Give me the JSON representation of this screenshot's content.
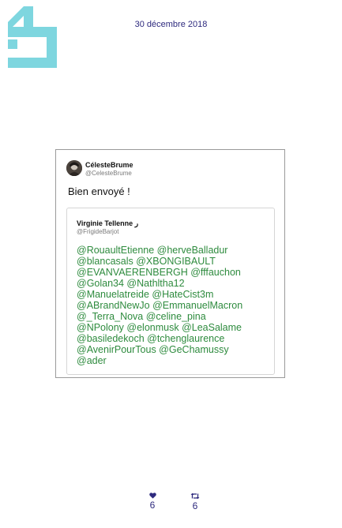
{
  "header": {
    "date": "30 décembre 2018"
  },
  "tweet": {
    "author_name": "CélesteBrume",
    "author_handle": "@CelesteBrume",
    "text": "Bien envoyé !",
    "quoted": {
      "author_name": "Virginie Tellenne ر",
      "author_handle": "@FrigideBarjot",
      "mention_lines": [
        "@RouaultEtienne @herveBalladur",
        "@blancasals @XBONGIBAULT",
        "@EVANVAERENBERGH @fffauchon",
        "@Golan34 @Nathltha12",
        "@Manuelatreide @HateCist3m",
        "@ABrandNewJo @EmmanuelMacron",
        "@_Terra_Nova @celine_pina",
        "@NPolony @elonmusk @LeaSalame",
        "@basiledekoch @tchenglaurence",
        "@AvenirPourTous @GeChamussy",
        "@ader"
      ]
    }
  },
  "stats": {
    "likes": "6",
    "retweets": "6"
  },
  "icons": {
    "logo": "brand-logo-icon",
    "like": "heart-icon",
    "retweet": "retweet-icon"
  },
  "colors": {
    "logo": "#7ed6df",
    "date_text": "#2e2a7e",
    "mention_text": "#2e8b3e",
    "card_border": "#9a9a9a",
    "stat_text": "#2e2a7e"
  }
}
